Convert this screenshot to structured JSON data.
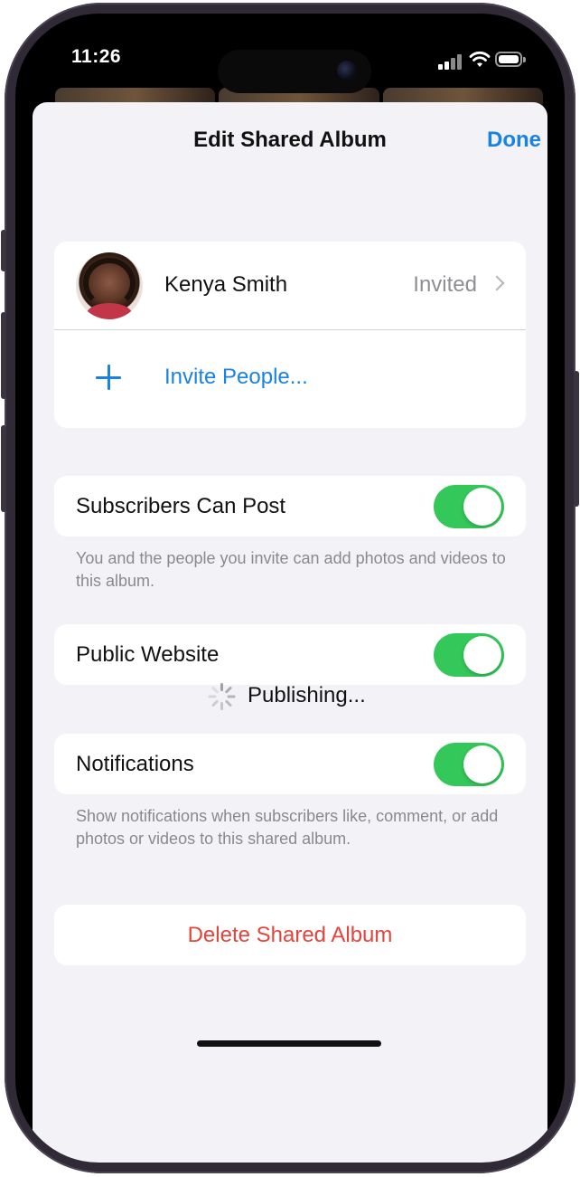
{
  "status_bar": {
    "time": "11:26"
  },
  "sheet": {
    "title": "Edit Shared Album",
    "done_label": "Done"
  },
  "people": {
    "members": [
      {
        "name": "Kenya Smith",
        "status": "Invited"
      }
    ],
    "invite_label": "Invite People..."
  },
  "settings": {
    "subscribers_can_post": {
      "label": "Subscribers Can Post",
      "enabled": true,
      "footnote": "You and the people you invite can add photos and videos to this album."
    },
    "public_website": {
      "label": "Public Website",
      "enabled": true,
      "status": "Publishing..."
    },
    "notifications": {
      "label": "Notifications",
      "enabled": true,
      "footnote": "Show notifications when subscribers like, comment, or add photos or videos to this shared album."
    }
  },
  "delete_label": "Delete Shared Album",
  "colors": {
    "accent": "#1a82e2",
    "toggle_on": "#34c759",
    "destructive": "#e5443b",
    "background": "#f2f2f7"
  }
}
